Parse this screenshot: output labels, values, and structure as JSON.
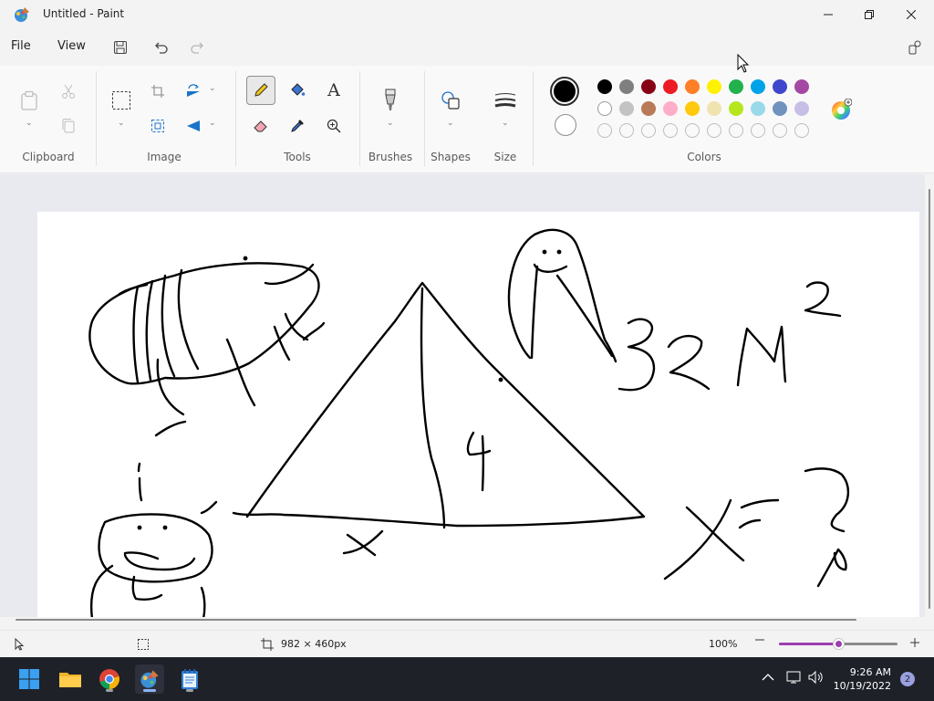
{
  "window": {
    "title": "Untitled - Paint"
  },
  "menu": {
    "file": "File",
    "view": "View"
  },
  "ribbon": {
    "groups": {
      "clipboard": "Clipboard",
      "image": "Image",
      "tools": "Tools",
      "brushes": "Brushes",
      "shapes": "Shapes",
      "size": "Size",
      "colors": "Colors"
    },
    "primary_color": "#000000",
    "secondary_color": "#ffffff",
    "palette_row1": [
      "#000000",
      "#7f7f7f",
      "#880015",
      "#ed1c24",
      "#ff7f27",
      "#fff200",
      "#22b14c",
      "#00a2e8",
      "#3f48cc",
      "#a349a4"
    ],
    "palette_row2": [
      "#ffffff",
      "#c3c3c3",
      "#b97a57",
      "#ffaec9",
      "#ffc90e",
      "#efe4b0",
      "#b5e61d",
      "#99d9ea",
      "#7092be",
      "#c8bfe7"
    ]
  },
  "canvas": {
    "drawing_text": {
      "four": "4",
      "x_label": "x",
      "eq_lhs": "x =",
      "question": "?",
      "num": "32M",
      "sup": "2"
    }
  },
  "status": {
    "canvas_size": "982 × 460px",
    "zoom": "100%",
    "zoom_level": 0.5
  },
  "taskbar": {
    "time": "9:26 AM",
    "date": "10/19/2022",
    "notifications": "2"
  }
}
